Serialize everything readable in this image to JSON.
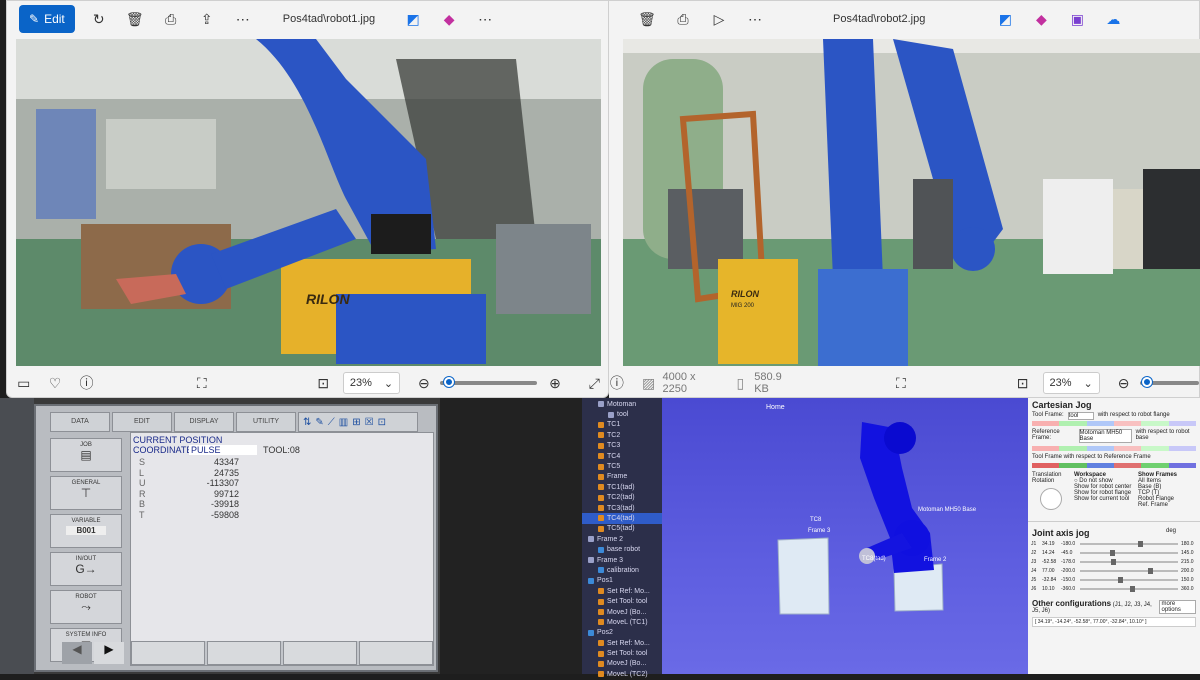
{
  "left_viewer": {
    "edit_label": "Edit",
    "filename": "Pos4tad\\robot1.jpg",
    "zoom": "23%",
    "zoom_level": 0.05
  },
  "right_viewer": {
    "filename": "Pos4tad\\robot2.jpg",
    "dimensions": "4000 x 2250",
    "filesize": "580.9 KB",
    "zoom": "23%",
    "zoom_level": 0.05
  },
  "photo1": {
    "sign": "RILON"
  },
  "photo2": {
    "sign": "RILON",
    "sub": "MIG 200"
  },
  "pendant": {
    "tabs": [
      "DATA",
      "EDIT",
      "DISPLAY",
      "UTILITY"
    ],
    "side_buttons": [
      "JOB",
      "GENERAL",
      "VARIABLE",
      "IN/OUT",
      "ROBOT",
      "SYSTEM INFO"
    ],
    "variable_value": "B001",
    "title": "CURRENT POSITION",
    "coordinate_label": "COORDINATE",
    "coordinate_value": "PULSE",
    "tool": "TOOL:08",
    "axes": [
      {
        "axis": "S",
        "value": "43347"
      },
      {
        "axis": "L",
        "value": "24735"
      },
      {
        "axis": "U",
        "value": "-113307"
      },
      {
        "axis": "R",
        "value": "99712"
      },
      {
        "axis": "B",
        "value": "-39918"
      },
      {
        "axis": "T",
        "value": "-59808"
      }
    ]
  },
  "station_tree": {
    "items": [
      {
        "label": "Motoman",
        "level": 1,
        "color": "#9aa0c8"
      },
      {
        "label": "tool",
        "level": 2,
        "color": "#9aa0c8"
      },
      {
        "label": "TC1",
        "level": 1,
        "color": "#e08a20"
      },
      {
        "label": "TC2",
        "level": 1,
        "color": "#e08a20"
      },
      {
        "label": "TC3",
        "level": 1,
        "color": "#e08a20"
      },
      {
        "label": "TC4",
        "level": 1,
        "color": "#e08a20"
      },
      {
        "label": "TC5",
        "level": 1,
        "color": "#e08a20"
      },
      {
        "label": "Frame",
        "level": 1,
        "color": "#e08a20"
      },
      {
        "label": "TC1(tad)",
        "level": 1,
        "color": "#e08a20"
      },
      {
        "label": "TC2(tad)",
        "level": 1,
        "color": "#e08a20"
      },
      {
        "label": "TC3(tad)",
        "level": 1,
        "color": "#e08a20"
      },
      {
        "label": "TC4(tad)",
        "level": 1,
        "color": "#e08a20",
        "selected": true
      },
      {
        "label": "TC5(tad)",
        "level": 1,
        "color": "#e08a20"
      },
      {
        "label": "Frame 2",
        "level": 0,
        "color": "#9aa0c8"
      },
      {
        "label": "base robot",
        "level": 1,
        "color": "#3c8ad8"
      },
      {
        "label": "Frame 3",
        "level": 0,
        "color": "#9aa0c8"
      },
      {
        "label": "calibration",
        "level": 1,
        "color": "#3c8ad8"
      },
      {
        "label": "Pos1",
        "level": 0,
        "color": "#3c8ad8"
      },
      {
        "label": "Set Ref: Mo...",
        "level": 1,
        "color": "#e08a20"
      },
      {
        "label": "Set Tool: tool",
        "level": 1,
        "color": "#e08a20"
      },
      {
        "label": "MoveJ (Bo...",
        "level": 1,
        "color": "#e08a20"
      },
      {
        "label": "MoveL (TC1)",
        "level": 1,
        "color": "#e08a20"
      },
      {
        "label": "Pos2",
        "level": 0,
        "color": "#3c8ad8"
      },
      {
        "label": "Set Ref: Mo...",
        "level": 1,
        "color": "#e08a20"
      },
      {
        "label": "Set Tool: tool",
        "level": 1,
        "color": "#e08a20"
      },
      {
        "label": "MoveJ (Bo...",
        "level": 1,
        "color": "#e08a20"
      },
      {
        "label": "MoveL (TC2)",
        "level": 1,
        "color": "#e08a20"
      }
    ]
  },
  "view3d": {
    "home_label": "Home",
    "tc_label": "TC8",
    "frame3_label": "Frame 3",
    "base_label": "Motoman MH50 Base",
    "tcp_label": "TC8(tad)",
    "frame2_label": "Frame 2"
  },
  "cartesian_panel": {
    "title": "Cartesian Jog",
    "tool_frame_label": "Tool Frame:",
    "tool_frame_value": "tool",
    "tool_frame_hint": "with respect to robot flange",
    "ref_frame_label": "Reference Frame:",
    "ref_frame_value": "Motoman MH50 Base",
    "ref_frame_hint": "with respect to robot base",
    "tool_ref_label": "Tool Frame with respect to Reference Frame",
    "workspace_label": "Workspace",
    "show_frames_label": "Show Frames",
    "options": [
      "Do not show",
      "Show for robot center",
      "Show for robot flange",
      "Show for current tool"
    ],
    "frames": [
      "All Items",
      "Base (B)",
      "TCP (T)",
      "Robot Flange",
      "Ref. Frame"
    ],
    "translation_label": "Translation",
    "rotation_label": "Rotation"
  },
  "joint_panel": {
    "title": "Joint axis jog",
    "unit": "deg",
    "joints": [
      {
        "name": "J1",
        "value": "34.19",
        "min": "-180.0",
        "max": "180.0",
        "level": 0.59
      },
      {
        "name": "J2",
        "value": "14.24",
        "min": "-45.0",
        "max": "145.0",
        "level": 0.31
      },
      {
        "name": "J3",
        "value": "-52.58",
        "min": "-178.0",
        "max": "215.0",
        "level": 0.32
      },
      {
        "name": "J4",
        "value": "77.00",
        "min": "-200.0",
        "max": "200.0",
        "level": 0.69
      },
      {
        "name": "J5",
        "value": "-32.84",
        "min": "-150.0",
        "max": "150.0",
        "level": 0.39
      },
      {
        "name": "J6",
        "value": "10.10",
        "min": "-360.0",
        "max": "360.0",
        "level": 0.51
      }
    ],
    "other_title": "Other configurations",
    "other_axes": "(J1, J2, J3, J4, J5, J6)",
    "more_options": "more options",
    "other_row": "[ 34.19°, -14.24°, -52.58°, 77.00°, -32.84°, 10.10° ]"
  }
}
